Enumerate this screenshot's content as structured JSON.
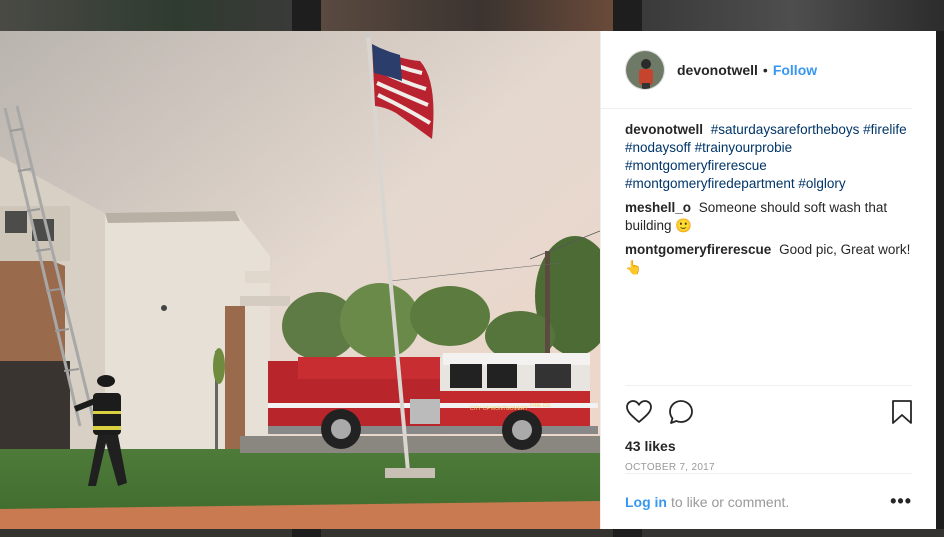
{
  "post": {
    "author": "devonotwell",
    "follow_label": "Follow",
    "separator": "•",
    "caption": {
      "user": "devonotwell",
      "hashtags": [
        "#saturdaysarefortheboys",
        "#firelife",
        "#nodaysoff",
        "#trainyourprobie",
        "#montgomeryfirerescue",
        "#montgomeryfiredepartment",
        "#olglory"
      ]
    },
    "comments": [
      {
        "user": "meshell_o",
        "text": "Someone should soft wash that building 🙂"
      },
      {
        "user": "montgomeryfirerescue",
        "text": "Good pic, Great work! 👆"
      }
    ],
    "likes": "43 likes",
    "date": "OCTOBER 7, 2017",
    "login_link": "Log in",
    "login_rest": "to like or comment.",
    "more": "•••"
  },
  "photo": {
    "truck_text_1": "CITY OF MONTGOMERY",
    "truck_text_2": "FIRE CO."
  },
  "colors": {
    "link": "#3897f0",
    "hashtag": "#003569",
    "truck_red": "#b8252a"
  },
  "icons": [
    "heart-icon",
    "comment-icon",
    "bookmark-icon",
    "more-icon"
  ]
}
